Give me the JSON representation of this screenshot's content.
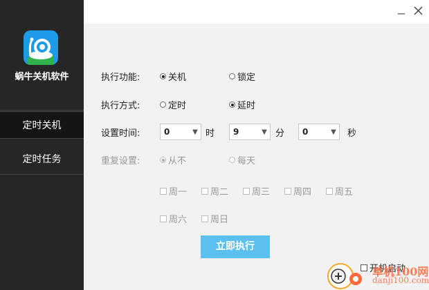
{
  "app": {
    "name": "蜗牛关机软件",
    "colors": {
      "sidebar": "#262626",
      "accent": "#5bc0ef",
      "logo_bg": "#1e9be8"
    }
  },
  "nav": {
    "items": [
      {
        "label": "定时关机",
        "active": true
      },
      {
        "label": "定时任务",
        "active": false
      }
    ]
  },
  "window": {
    "minimize_icon": "minimize-icon",
    "close_icon": "close-icon"
  },
  "form": {
    "function": {
      "label": "执行功能:",
      "options": [
        {
          "label": "关机",
          "checked": true
        },
        {
          "label": "锁定",
          "checked": false
        }
      ]
    },
    "mode": {
      "label": "执行方式:",
      "options": [
        {
          "label": "定时",
          "checked": false
        },
        {
          "label": "延时",
          "checked": true
        }
      ]
    },
    "time": {
      "label": "设置时间:",
      "hours": {
        "value": "0",
        "unit": "时"
      },
      "minutes": {
        "value": "9",
        "unit": "分"
      },
      "seconds": {
        "value": "0",
        "unit": "秒"
      }
    },
    "repeat": {
      "label": "重复设置:",
      "options": [
        {
          "label": "从不",
          "checked": true
        },
        {
          "label": "每天",
          "checked": false
        }
      ]
    },
    "weekdays": [
      "周一",
      "周二",
      "周三",
      "周四",
      "周五",
      "周六",
      "周日"
    ],
    "run_button": "立即执行",
    "autostart": {
      "label": "开机启动",
      "checked": false
    }
  },
  "watermark": {
    "text_main": "单机100网",
    "text_sub": "danji100.com"
  }
}
